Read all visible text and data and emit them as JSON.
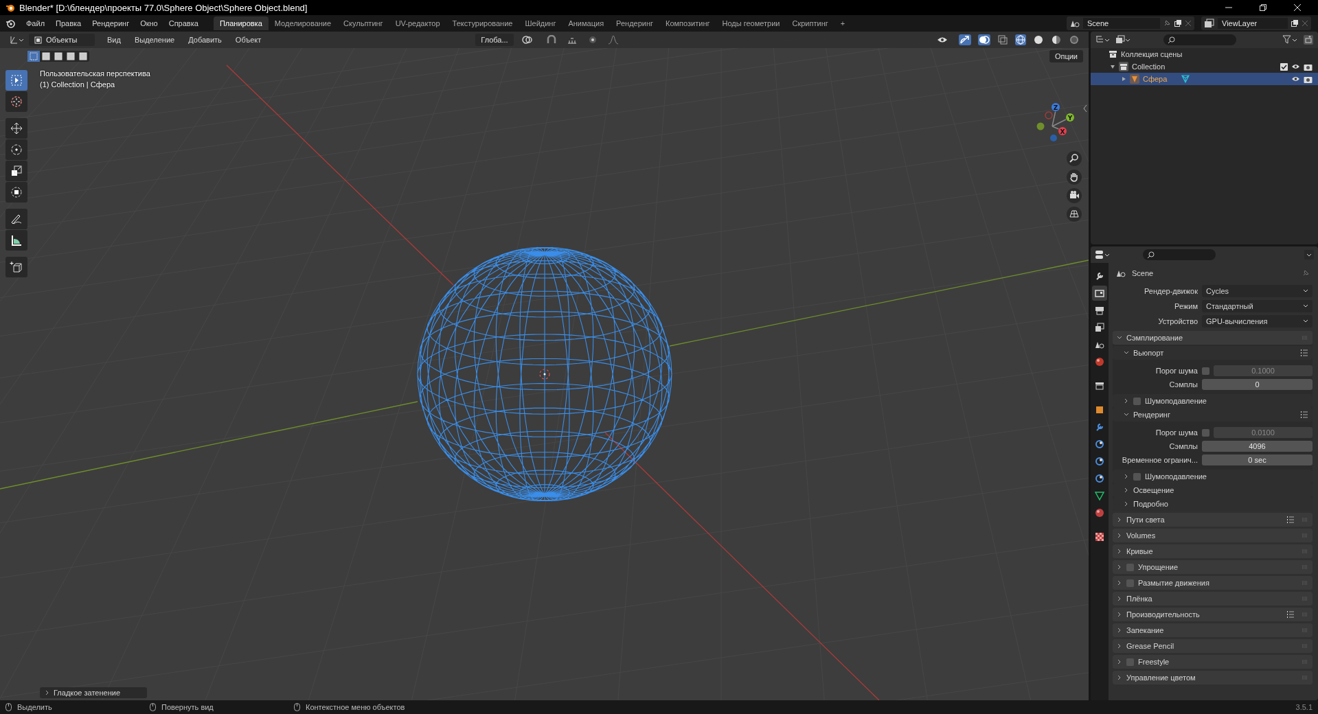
{
  "window": {
    "title": "Blender* [D:\\блендер\\проекты 77.0\\Sphere Object\\Sphere Object.blend]"
  },
  "menu": [
    "Файл",
    "Правка",
    "Рендеринг",
    "Окно",
    "Справка"
  ],
  "workspaces": [
    {
      "label": "Планировка",
      "selected": true
    },
    {
      "label": "Моделирование",
      "selected": false
    },
    {
      "label": "Скульптинг",
      "selected": false
    },
    {
      "label": "UV-редактор",
      "selected": false
    },
    {
      "label": "Текстурирование",
      "selected": false
    },
    {
      "label": "Шейдинг",
      "selected": false
    },
    {
      "label": "Анимация",
      "selected": false
    },
    {
      "label": "Рендеринг",
      "selected": false
    },
    {
      "label": "Композитинг",
      "selected": false
    },
    {
      "label": "Ноды геометрии",
      "selected": false
    },
    {
      "label": "Скриптинг",
      "selected": false
    }
  ],
  "add_workspace": "+",
  "scene_selector": {
    "value": "Scene"
  },
  "view_layer_selector": {
    "value": "ViewLayer"
  },
  "viewport": {
    "mode": "Объекты",
    "menus": [
      "Вид",
      "Выделение",
      "Добавить",
      "Объект"
    ],
    "orientation": "Глоба...",
    "options": "Опции",
    "info": [
      "Пользовательская перспектива",
      "(1) Collection | Сфера"
    ],
    "select_modes": [
      {
        "selected": true
      },
      {
        "selected": false
      },
      {
        "selected": false
      },
      {
        "selected": false
      },
      {
        "selected": false
      }
    ],
    "tools": [
      {
        "kind": "select",
        "selected": true
      },
      {
        "kind": "cursor",
        "selected": false
      },
      {
        "kind": "move",
        "selected": false
      },
      {
        "kind": "rotate",
        "selected": false
      },
      {
        "kind": "scale",
        "selected": false
      },
      {
        "kind": "transform",
        "selected": false
      },
      {
        "kind": "annotate",
        "selected": false
      },
      {
        "kind": "measure",
        "selected": false
      },
      {
        "kind": "add_cube",
        "selected": false
      }
    ],
    "gizmo_labels": [
      "Z",
      "Y",
      "X"
    ],
    "last_operator": "Гладкое затенение"
  },
  "outliner": {
    "items": [
      {
        "label": "Коллекция сцены",
        "children": [
          {
            "label": "Collection",
            "expanded": true,
            "checked": true,
            "children": [
              {
                "label": "Сфера",
                "expanded": false,
                "selected": true
              }
            ]
          }
        ]
      }
    ]
  },
  "properties": {
    "context": "Scene",
    "tabs": [
      {
        "kind": "tool",
        "selected": false
      },
      {
        "kind": "render",
        "selected": true
      },
      {
        "kind": "output",
        "selected": false
      },
      {
        "kind": "view_layer",
        "selected": false
      },
      {
        "kind": "scene",
        "selected": false
      },
      {
        "kind": "world",
        "selected": false
      },
      {
        "kind": "collection",
        "selected": false
      },
      {
        "kind": "object",
        "selected": false
      },
      {
        "kind": "modifiers",
        "selected": false
      },
      {
        "kind": "particles",
        "selected": false
      },
      {
        "kind": "physics",
        "selected": false
      },
      {
        "kind": "constraints",
        "selected": false
      },
      {
        "kind": "data",
        "selected": false
      },
      {
        "kind": "material",
        "selected": false
      },
      {
        "kind": "texture",
        "selected": false
      }
    ],
    "fields": [
      {
        "label": "Рендер-движок",
        "value": "Cycles"
      },
      {
        "label": "Режим",
        "value": "Стандартный"
      },
      {
        "label": "Устройство",
        "value": "GPU-вычисления"
      }
    ],
    "panels": [
      {
        "label": "Сэмплирование",
        "expanded": true,
        "presets": false,
        "subpanels": [
          {
            "label": "Вьюпорт",
            "expanded": true,
            "presets": true,
            "rows": [
              {
                "kind": "threshold",
                "label": "Порог шума",
                "checked": false,
                "value": "0.1000"
              },
              {
                "kind": "number",
                "label": "Сэмплы",
                "value": "0"
              }
            ]
          },
          {
            "label": "Шумоподавление",
            "expanded": false,
            "presets": false,
            "checked": false
          },
          {
            "label": "Рендеринг",
            "expanded": true,
            "presets": true,
            "rows": [
              {
                "kind": "threshold",
                "label": "Порог шума",
                "checked": false,
                "value": "0.0100"
              },
              {
                "kind": "number",
                "label": "Сэмплы",
                "value": "4096"
              },
              {
                "kind": "number",
                "label": "Временное огранич...",
                "value": "0 sec"
              }
            ]
          },
          {
            "label": "Шумоподавление",
            "expanded": false,
            "presets": false,
            "checked": false
          },
          {
            "label": "Освещение",
            "expanded": false,
            "presets": false
          },
          {
            "label": "Подробно",
            "expanded": false,
            "presets": false
          }
        ]
      },
      {
        "label": "Пути света",
        "expanded": false,
        "presets": true
      },
      {
        "label": "Volumes",
        "expanded": false,
        "presets": false
      },
      {
        "label": "Кривые",
        "expanded": false,
        "presets": false
      },
      {
        "label": "Упрощение",
        "expanded": false,
        "presets": false,
        "checked": false
      },
      {
        "label": "Размытие движения",
        "expanded": false,
        "presets": false,
        "checked": false
      },
      {
        "label": "Плёнка",
        "expanded": false,
        "presets": false
      },
      {
        "label": "Производительность",
        "expanded": false,
        "presets": true
      },
      {
        "label": "Запекание",
        "expanded": false,
        "presets": false
      },
      {
        "label": "Grease Pencil",
        "expanded": false,
        "presets": false
      },
      {
        "label": "Freestyle",
        "expanded": false,
        "presets": false,
        "checked": false
      },
      {
        "label": "Управление цветом",
        "expanded": false,
        "presets": false
      }
    ]
  },
  "status_bar": {
    "hints": [
      "Выделить",
      "Повернуть вид",
      "Контекстное меню объектов"
    ],
    "version": "3.5.1"
  }
}
